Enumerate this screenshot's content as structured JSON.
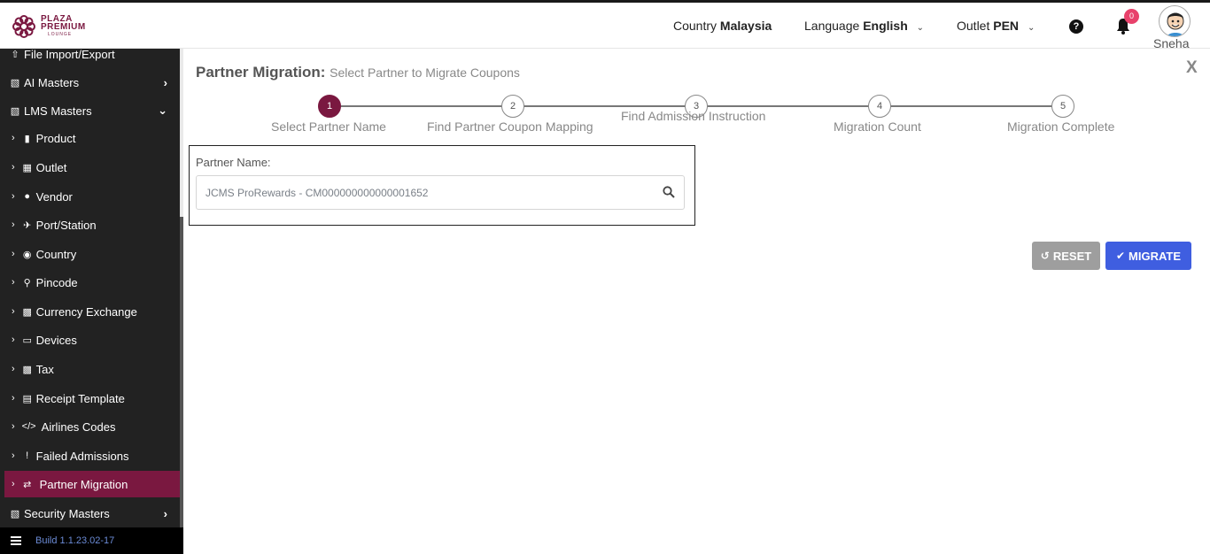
{
  "header": {
    "logo": {
      "line1": "PLAZA",
      "line2": "PREMIUM",
      "line3": "LOUNGE"
    },
    "country_label": "Country",
    "country_value": "Malaysia",
    "language_label": "Language",
    "language_value": "English",
    "outlet_label": "Outlet",
    "outlet_value": "PEN",
    "notification_count": "0",
    "username": "Sneha"
  },
  "sidebar": {
    "items": [
      {
        "label": "File Import/Export"
      },
      {
        "label": "AI Masters"
      },
      {
        "label": "LMS Masters"
      },
      {
        "label": "Product"
      },
      {
        "label": "Outlet"
      },
      {
        "label": "Vendor"
      },
      {
        "label": "Port/Station"
      },
      {
        "label": "Country"
      },
      {
        "label": "Pincode"
      },
      {
        "label": "Currency Exchange"
      },
      {
        "label": "Devices"
      },
      {
        "label": "Tax"
      },
      {
        "label": "Receipt Template"
      },
      {
        "label": "Airlines Codes"
      },
      {
        "label": "Failed Admissions"
      },
      {
        "label": "Partner Migration"
      },
      {
        "label": "Security Masters"
      }
    ],
    "build": "Build 1.1.23.02-17"
  },
  "main": {
    "title": "Partner Migration:",
    "subtitle": "Select Partner to Migrate Coupons",
    "close_label": "X",
    "steps": [
      {
        "number": "1",
        "label": "Select Partner Name"
      },
      {
        "number": "2",
        "label": "Find Partner Coupon Mapping"
      },
      {
        "number": "3",
        "label": "Find Admission Instruction"
      },
      {
        "number": "4",
        "label": "Migration Count"
      },
      {
        "number": "5",
        "label": "Migration Complete"
      }
    ],
    "active_step": 1,
    "partner_label": "Partner Name:",
    "partner_value": "JCMS ProRewards - CM000000000000001652",
    "reset_label": "RESET",
    "migrate_label": "MIGRATE"
  },
  "colors": {
    "accent": "#7a1840",
    "primary_button": "#3f5ee0",
    "secondary_button": "#9e9e9e",
    "sidebar_bg": "#222222",
    "badge": "#e8416b"
  }
}
